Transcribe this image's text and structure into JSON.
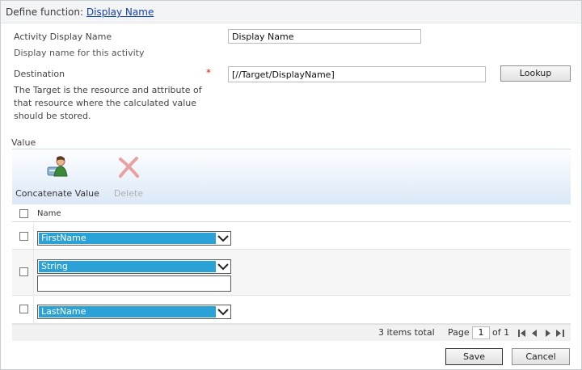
{
  "title_bar": {
    "label": "Define function: ",
    "link": "Display Name"
  },
  "activity_name": {
    "label": "Activity Display Name",
    "hint": "Display name for this activity",
    "value": "Display Name"
  },
  "destination": {
    "label": "Destination",
    "required": "*",
    "hint1": "The Target is the resource and attribute of",
    "hint2": "that resource where the calculated value",
    "hint3": "should be stored.",
    "value": "[//Target/DisplayName]",
    "lookup_label": "Lookup"
  },
  "value_section": {
    "label": "Value"
  },
  "ribbon": {
    "concatenate_label": "Concatenate Value",
    "delete_label": "Delete",
    "concatenate_icon": "user-add-icon",
    "delete_icon": "delete-x-icon"
  },
  "grid": {
    "column_name": "Name",
    "rows": [
      {
        "selected": "FirstName"
      },
      {
        "selected": "String",
        "text_value": ""
      },
      {
        "selected": "LastName"
      }
    ],
    "accent": "#2aa2d8"
  },
  "footer": {
    "items_total": "3 items total",
    "page_label": "Page",
    "page_value": "1",
    "of_label": "of 1"
  },
  "buttons": {
    "save": "Save",
    "cancel": "Cancel"
  }
}
